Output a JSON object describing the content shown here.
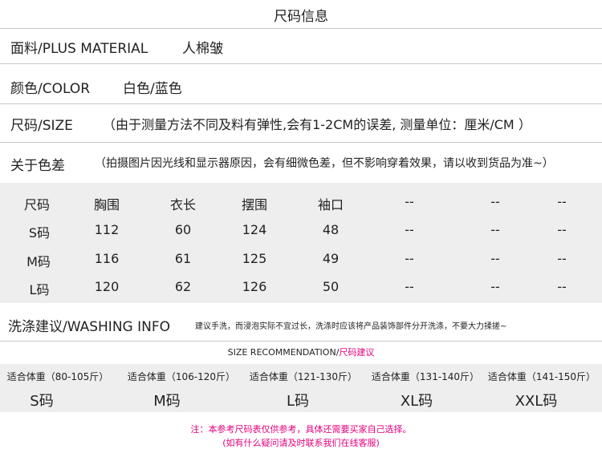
{
  "title": "尺码信息",
  "info_rows": {
    "material": {
      "label": "面料/PLUS MATERIAL",
      "value": "人棉皱"
    },
    "color": {
      "label": "颜色/COLOR",
      "value": "白色/蓝色"
    },
    "size": {
      "label": "尺码/SIZE",
      "value": "（由于测量方法不同及料有弹性,会有1-2CM的误差, 测量单位：厘米/CM ）"
    },
    "chromatic": {
      "label": "关于色差",
      "value": "（拍摄图片因光线和显示器原因，会有细微色差，但不影响穿着效果，请以收到货品为准~）"
    }
  },
  "size_table": {
    "headers": [
      "尺码",
      "胸围",
      "衣长",
      "摆围",
      "袖口",
      "--",
      "--",
      "--"
    ],
    "rows": [
      [
        "S码",
        "112",
        "60",
        "124",
        "48",
        "--",
        "--",
        "--"
      ],
      [
        "M码",
        "116",
        "61",
        "125",
        "49",
        "--",
        "--",
        "--"
      ],
      [
        "L码",
        "120",
        "62",
        "126",
        "50",
        "--",
        "--",
        "--"
      ]
    ]
  },
  "washing": {
    "label": "洗涤建议/WASHING INFO",
    "note": "建议手洗，而浸泡实际不宜过长，洗涤时应该将产品装饰部件分开洗涤，不要大力揉搓~"
  },
  "recommendation": {
    "title_en": "SIZE RECOMMENDATION/",
    "title_cn": "尺码建议",
    "items": [
      {
        "weight": "适合体重（80-105斤）",
        "size": "S码"
      },
      {
        "weight": "适合体重（106-120斤）",
        "size": "M码"
      },
      {
        "weight": "适合体重（121-130斤）",
        "size": "L码"
      },
      {
        "weight": "适合体重（131-140斤）",
        "size": "XL码"
      },
      {
        "weight": "适合体重（141-150斤）",
        "size": "XXL码"
      }
    ]
  },
  "footnote": {
    "line1": "注：本参考尺码表仅供参考，具体还需要买家自己选择。",
    "line2": "(如有什么疑问请及时联系我们在线客服)"
  },
  "colors": {
    "accent_pink": "#e4007f",
    "band_gray": "#eeeeee",
    "divider": "#c8c8c8"
  }
}
